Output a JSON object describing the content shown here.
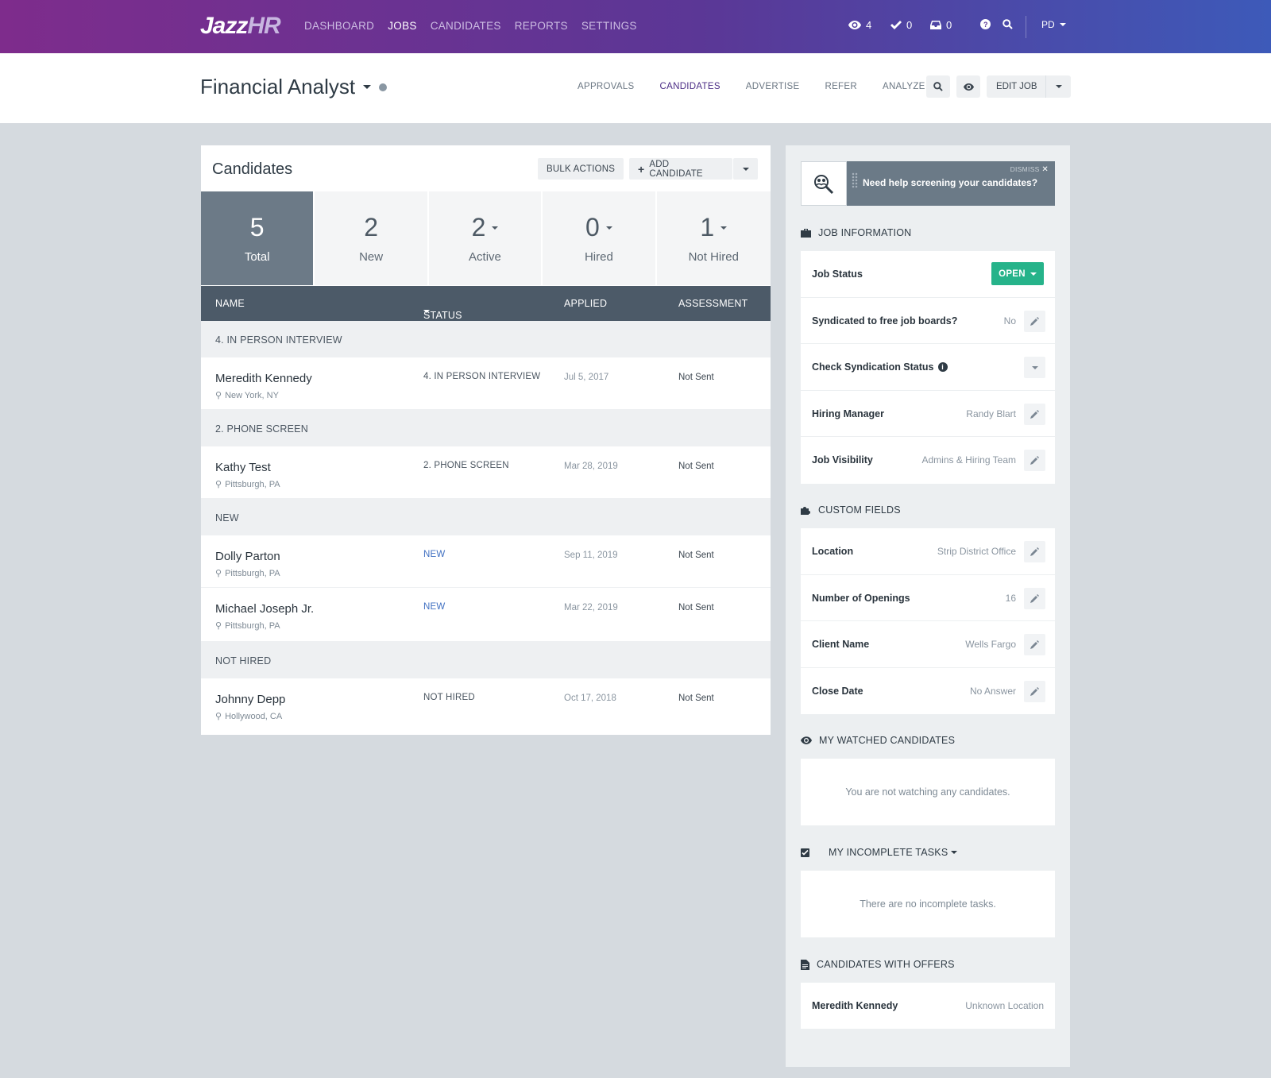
{
  "topnav": {
    "logo_main": "Jazz",
    "logo_accent": "HR",
    "items": [
      {
        "label": "DASHBOARD",
        "active": false
      },
      {
        "label": "JOBS",
        "active": true
      },
      {
        "label": "CANDIDATES",
        "active": false
      },
      {
        "label": "REPORTS",
        "active": false
      },
      {
        "label": "SETTINGS",
        "active": false
      }
    ],
    "watch_count": "4",
    "check_count": "0",
    "inbox_count": "0",
    "user_initials": "PD"
  },
  "job": {
    "title": "Financial Analyst",
    "tabs": [
      "APPROVALS",
      "CANDIDATES",
      "ADVERTISE",
      "REFER",
      "ANALYZE"
    ],
    "active_tab": "CANDIDATES",
    "edit_label": "EDIT JOB"
  },
  "candidates_panel": {
    "title": "Candidates",
    "bulk_actions": "BULK ACTIONS",
    "add_candidate": "ADD CANDIDATE",
    "stats": [
      {
        "num": "5",
        "label": "Total"
      },
      {
        "num": "2",
        "label": "New"
      },
      {
        "num": "2",
        "label": "Active"
      },
      {
        "num": "0",
        "label": "Hired"
      },
      {
        "num": "1",
        "label": "Not Hired"
      }
    ],
    "columns": {
      "name": "NAME",
      "status": "STATUS",
      "applied": "APPLIED",
      "assessment": "ASSESSMENT"
    },
    "groups": [
      {
        "label": "4. IN PERSON INTERVIEW",
        "rows": [
          {
            "name": "Meredith Kennedy",
            "location": "New York, NY",
            "status": "4. IN PERSON INTERVIEW",
            "applied": "Jul 5, 2017",
            "assessment": "Not Sent"
          }
        ]
      },
      {
        "label": "2. PHONE SCREEN",
        "rows": [
          {
            "name": "Kathy Test",
            "location": "Pittsburgh, PA",
            "status": "2. PHONE SCREEN",
            "applied": "Mar 28, 2019",
            "assessment": "Not Sent"
          }
        ]
      },
      {
        "label": "NEW",
        "rows": [
          {
            "name": "Dolly Parton",
            "location": "Pittsburgh, PA",
            "status": "NEW",
            "applied": "Sep 11, 2019",
            "assessment": "Not Sent"
          },
          {
            "name": "Michael Joseph Jr.",
            "location": "Pittsburgh, PA",
            "status": "NEW",
            "applied": "Mar 22, 2019",
            "assessment": "Not Sent"
          }
        ]
      },
      {
        "label": "NOT HIRED",
        "rows": [
          {
            "name": "Johnny Depp",
            "location": "Hollywood, CA",
            "status": "NOT HIRED",
            "applied": "Oct 17, 2018",
            "assessment": "Not Sent"
          }
        ]
      }
    ]
  },
  "sidebar": {
    "banner": {
      "text": "Need help screening your candidates?",
      "dismiss": "DISMISS"
    },
    "job_info": {
      "title": "JOB INFORMATION",
      "job_status_label": "Job Status",
      "job_status_value": "OPEN",
      "syndicated_label": "Syndicated to free job boards?",
      "syndicated_value": "No",
      "check_syndication_label": "Check Syndication Status",
      "hiring_manager_label": "Hiring Manager",
      "hiring_manager_value": "Randy Blart",
      "visibility_label": "Job Visibility",
      "visibility_value": "Admins & Hiring Team"
    },
    "custom_fields": {
      "title": "CUSTOM FIELDS",
      "location_label": "Location",
      "location_value": "Strip District Office",
      "openings_label": "Number of Openings",
      "openings_value": "16",
      "client_label": "Client Name",
      "client_value": "Wells Fargo",
      "close_label": "Close Date",
      "close_value": "No Answer"
    },
    "watched": {
      "title": "MY WATCHED CANDIDATES",
      "empty": "You are not watching any candidates."
    },
    "tasks": {
      "title": "MY INCOMPLETE TASKS",
      "empty": "There are no incomplete tasks."
    },
    "offers": {
      "title": "CANDIDATES WITH OFFERS",
      "name": "Meredith Kennedy",
      "location": "Unknown Location"
    }
  }
}
